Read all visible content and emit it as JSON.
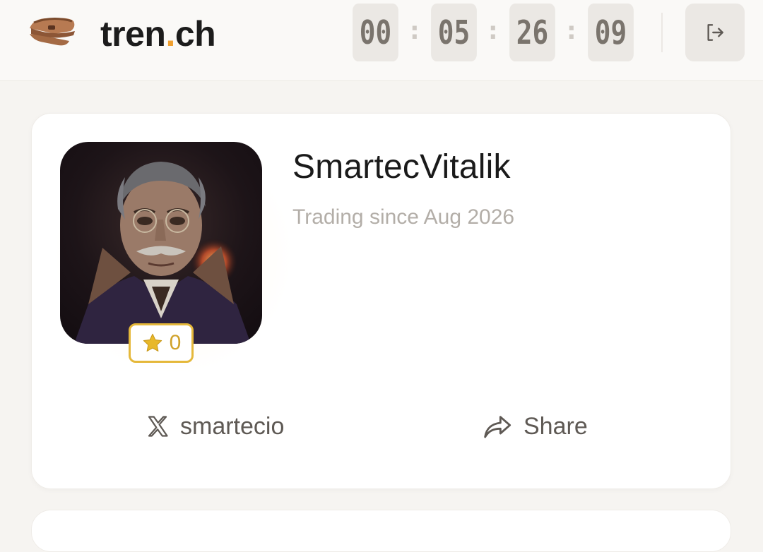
{
  "header": {
    "brand_prefix": "tren",
    "brand_dot": ".",
    "brand_suffix": "ch",
    "logo_icon": "hat-icon",
    "timer": {
      "d": "00",
      "h": "05",
      "m": "26",
      "s": "09",
      "separator": ":"
    },
    "logout_icon": "logout-icon"
  },
  "profile": {
    "username": "SmartecVitalik",
    "trading_since": "Trading since Aug 2026",
    "rating": "0",
    "rating_icon": "star-icon",
    "x_handle": "smartecio",
    "x_icon": "x-logo-icon",
    "share_label": "Share",
    "share_icon": "share-icon"
  },
  "colors": {
    "accent": "#f0a030",
    "badge_border": "#e5b83a",
    "star": "#e8b82a"
  }
}
